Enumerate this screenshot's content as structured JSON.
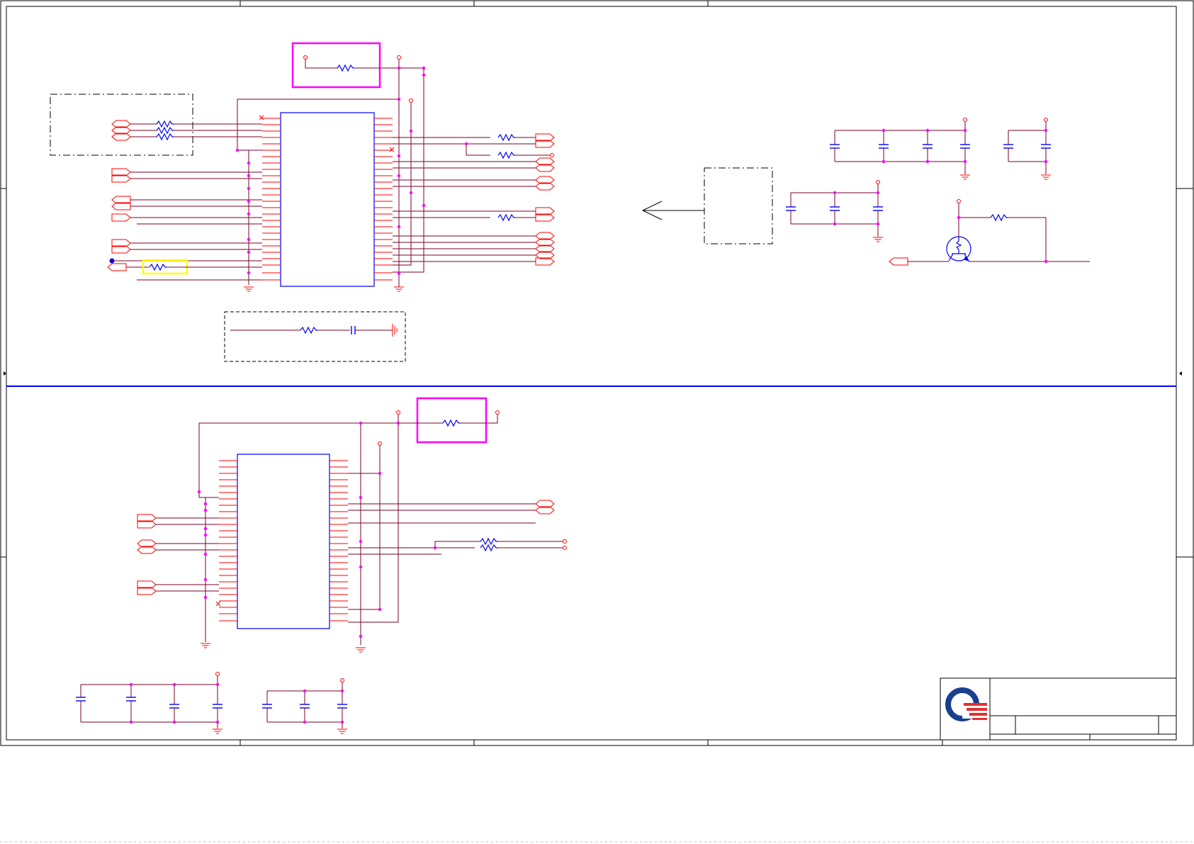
{
  "sheet": {
    "background": "#ffffff",
    "colors": {
      "frame": "#000000",
      "wire": "#7a0026",
      "pin": "#ff0000",
      "junction": "#ff00ff",
      "component": "#0000ff",
      "highlight_magenta": "#ff00ff",
      "highlight_yellow": "#ffff00",
      "divider": "#0000ff",
      "logo_blue": "#1b3f8f",
      "logo_red": "#e03030"
    }
  },
  "title_block": {
    "logo": "logo-icon"
  },
  "icons": [
    "resistor-icon",
    "capacitor-icon",
    "ground-icon",
    "power-port-icon",
    "transistor-icon",
    "net-port-icon",
    "arrow-icon"
  ]
}
